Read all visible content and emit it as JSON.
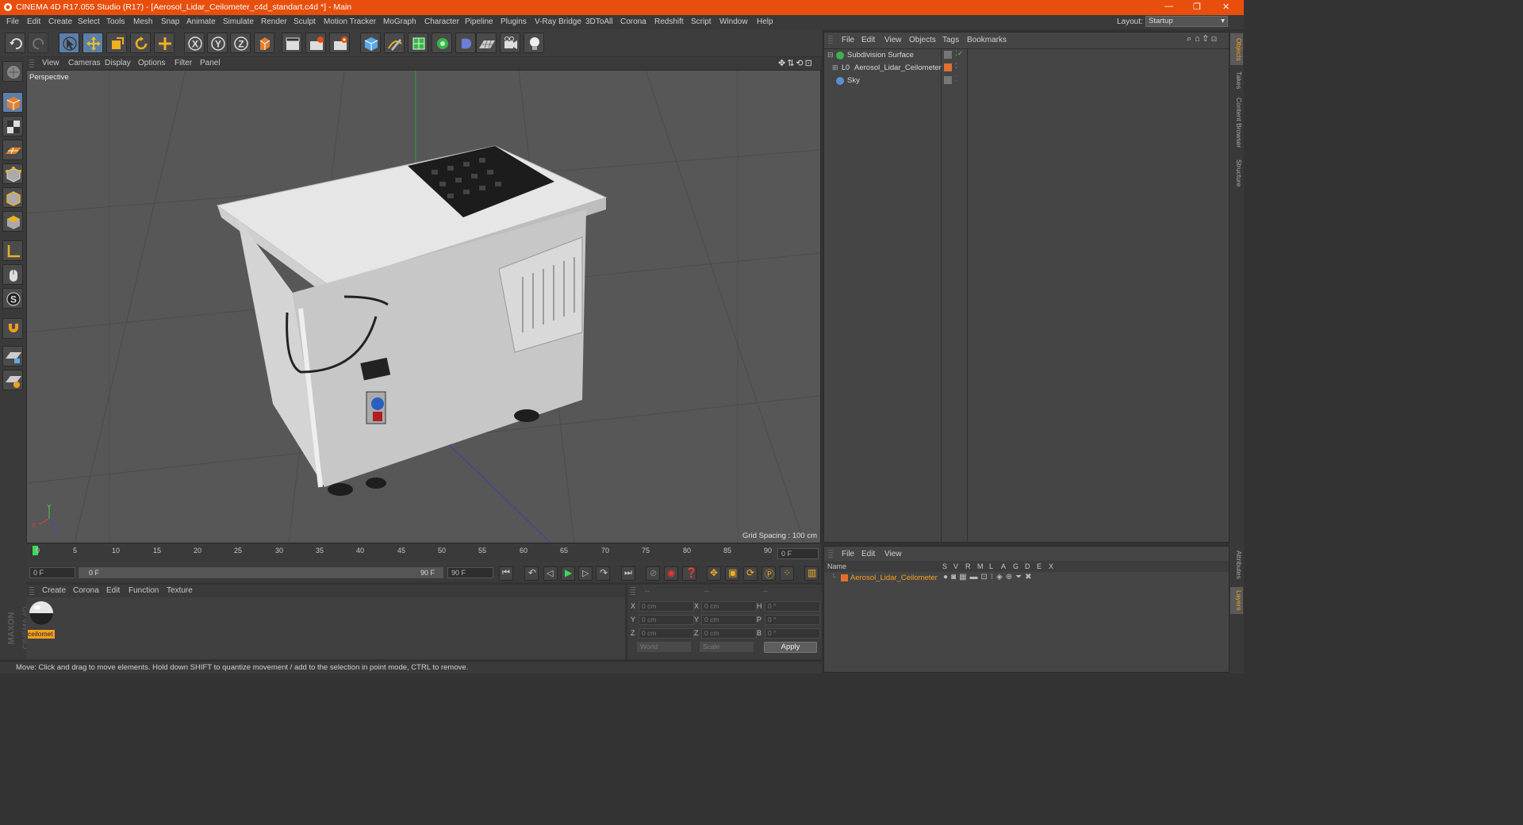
{
  "window": {
    "title": "CINEMA 4D R17.055 Studio (R17) - [Aerosol_Lidar_Ceilometer_c4d_standart.c4d *] - Main",
    "controls": [
      "—",
      "❐",
      "✕"
    ]
  },
  "menubar": {
    "items": [
      "File",
      "Edit",
      "Create",
      "Select",
      "Tools",
      "Mesh",
      "Snap",
      "Animate",
      "Simulate",
      "Render",
      "Sculpt",
      "Motion Tracker",
      "MoGraph",
      "Character",
      "Pipeline",
      "Plugins",
      "V-Ray Bridge",
      "3DToAll",
      "Corona",
      "Redshift",
      "Script",
      "Window",
      "Help"
    ],
    "layout_label": "Layout:",
    "layout_value": "Startup"
  },
  "toolbar": {
    "axis_x": "X",
    "axis_y": "Y",
    "axis_z": "Z"
  },
  "viewport": {
    "menu": [
      "View",
      "Cameras",
      "Display",
      "Options",
      "Filter",
      "Panel"
    ],
    "camera_label": "Perspective",
    "grid_spacing": "Grid Spacing : 100 cm",
    "axis_labels": {
      "y": "Y",
      "x": "X",
      "z": "Z"
    }
  },
  "timeline": {
    "ticks": [
      "0",
      "5",
      "10",
      "15",
      "20",
      "25",
      "30",
      "35",
      "40",
      "45",
      "50",
      "55",
      "60",
      "65",
      "70",
      "75",
      "80",
      "85",
      "90"
    ],
    "current_frame": "0 F"
  },
  "transport": {
    "start_field": "0 F",
    "range_start": "0 F",
    "range_end": "90 F",
    "end_field": "90 F"
  },
  "material_manager": {
    "menu": [
      "Create",
      "Corona",
      "Edit",
      "Function",
      "Texture"
    ],
    "materials": [
      {
        "label": "ceilomet"
      }
    ]
  },
  "coordinates": {
    "headers": [
      "--",
      "--",
      "--"
    ],
    "rows": [
      {
        "l1": "X",
        "v1": "0 cm",
        "l2": "X",
        "v2": "0 cm",
        "l3": "H",
        "v3": "0 °"
      },
      {
        "l1": "Y",
        "v1": "0 cm",
        "l2": "Y",
        "v2": "0 cm",
        "l3": "P",
        "v3": "0 °"
      },
      {
        "l1": "Z",
        "v1": "0 cm",
        "l2": "Z",
        "v2": "0 cm",
        "l3": "B",
        "v3": "0 °"
      }
    ],
    "mode_world": "World",
    "mode_scale": "Scale",
    "apply": "Apply"
  },
  "objects_panel": {
    "menu": [
      "File",
      "Edit",
      "View",
      "Objects",
      "Tags",
      "Bookmarks"
    ],
    "objects": [
      {
        "name": "Subdivision Surface",
        "color": "#39b54a"
      },
      {
        "name": "Aerosol_Lidar_Ceilometer",
        "color": "#e07030"
      },
      {
        "name": "Sky",
        "color": "#5a8fd0"
      }
    ]
  },
  "layers_panel": {
    "menu": [
      "File",
      "Edit",
      "View"
    ],
    "col_name": "Name",
    "cols": [
      "S",
      "V",
      "R",
      "M",
      "L",
      "A",
      "G",
      "D",
      "E",
      "X"
    ],
    "layer_name": "Aerosol_Lidar_Ceilometer",
    "layer_color": "#e07030"
  },
  "right_tabs": [
    "Objects",
    "Takes",
    "Content Browser",
    "Structure",
    "Attributes",
    "Layers"
  ],
  "brand": {
    "maxon": "MAXON",
    "cinema": "CINEMA 4D"
  },
  "status": "Move: Click and drag to move elements. Hold down SHIFT to quantize movement / add to the selection in point mode, CTRL to remove.",
  "colors": {
    "accent": "#e84f0c",
    "selected_tool": "#5c7fa8",
    "viewport_bg": "#575757"
  }
}
